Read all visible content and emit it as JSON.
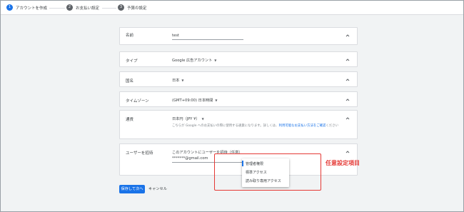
{
  "stepper": {
    "steps": [
      {
        "num": "1",
        "label": "アカウントを作成",
        "active": true
      },
      {
        "num": "2",
        "label": "お支払い設定",
        "active": false
      },
      {
        "num": "3",
        "label": "予算の設定",
        "active": false
      }
    ]
  },
  "cards": {
    "name": {
      "label": "名前",
      "value": "test"
    },
    "type": {
      "label": "タイプ",
      "value": "Google 広告アカウント"
    },
    "country": {
      "label": "国名",
      "value": "日本"
    },
    "timezone": {
      "label": "タイムゾーン",
      "value": "(GMT+09:00) 日本時間"
    },
    "currency": {
      "label": "通貨",
      "value": "日本円（JPY ¥）",
      "note_before": "こちらが Google へのお支払いの際に使用する通貨になります。詳しくは、",
      "note_link": "利用可能なお支払い方法をご確認",
      "note_after": "ください"
    },
    "invite": {
      "label": "ユーザーを招待",
      "value": "このアカウントにユーザーを招待（任意）",
      "email": "*******@gmail.com"
    }
  },
  "dropdown": {
    "items": [
      "管理者権限",
      "標準アクセス",
      "読み取り専用アクセス"
    ]
  },
  "callout": "任意設定項目",
  "buttons": {
    "save": "保存して次へ",
    "cancel": "キャンセル"
  },
  "colors": {
    "primary": "#1a73e8",
    "annotation": "#e53935"
  }
}
